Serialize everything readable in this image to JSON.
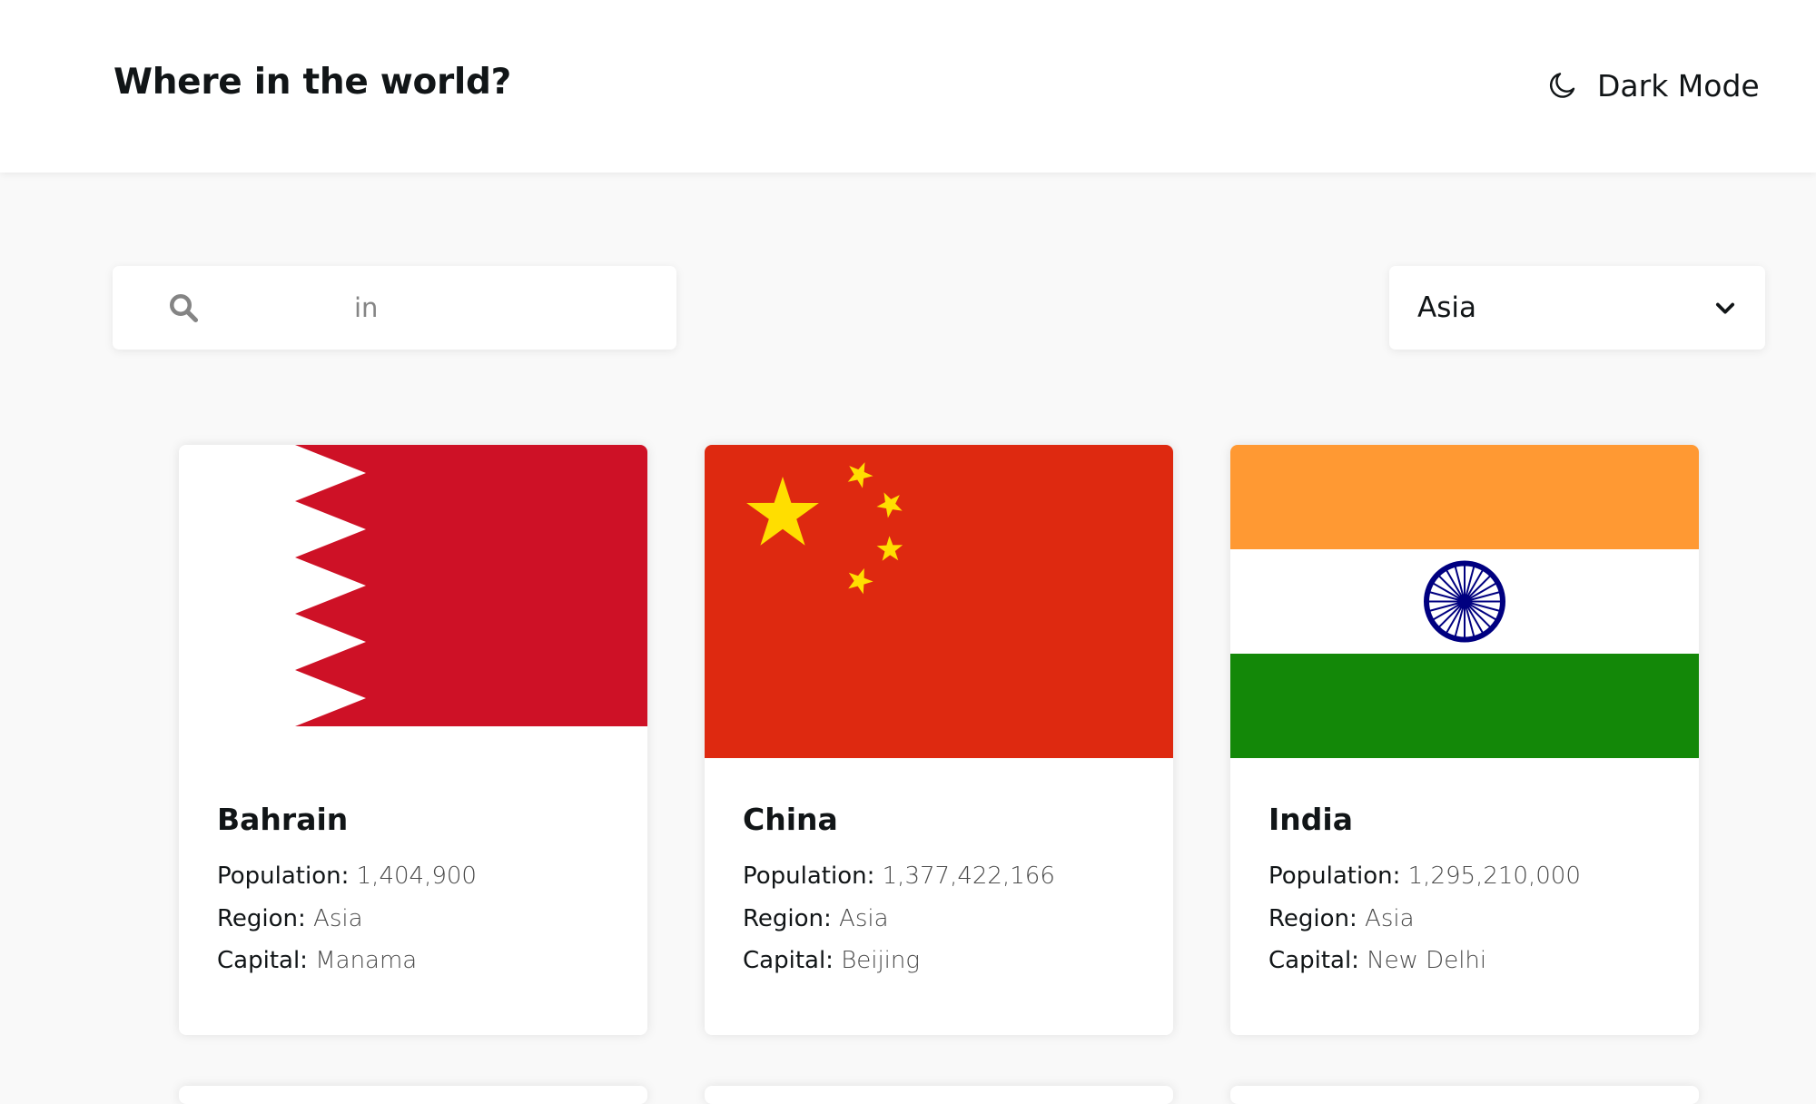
{
  "header": {
    "title": "Where in the world?",
    "dark_mode_label": "Dark Mode",
    "dark_mode_icon": "moon-icon"
  },
  "search": {
    "icon": "search-icon",
    "value": "in"
  },
  "filter": {
    "selected": "Asia",
    "icon": "chevron-down-icon"
  },
  "labels": {
    "population": "Population:",
    "region": "Region:",
    "capital": "Capital:"
  },
  "countries": [
    {
      "name": "Bahrain",
      "population": "1,404,900",
      "region": "Asia",
      "capital": "Manama",
      "flag": "bahrain-flag"
    },
    {
      "name": "China",
      "population": "1,377,422,166",
      "region": "Asia",
      "capital": "Beijing",
      "flag": "china-flag"
    },
    {
      "name": "India",
      "population": "1,295,210,000",
      "region": "Asia",
      "capital": "New Delhi",
      "flag": "india-flag"
    }
  ],
  "colors": {
    "background": "#f9f9f9",
    "element": "#ffffff",
    "text": "#111517",
    "input_text": "#858585",
    "bahrain_red": "#CE1126",
    "china_red": "#DE2910",
    "china_yellow": "#FFDE00",
    "india_saffron": "#FF9933",
    "india_green": "#138808",
    "india_navy": "#000080"
  }
}
